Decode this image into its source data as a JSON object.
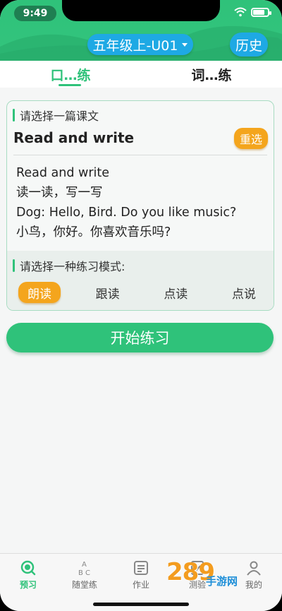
{
  "status_bar": {
    "time": "9:49"
  },
  "header": {
    "grade_selector": "五年级上-U01",
    "history_button": "历史"
  },
  "tabs": [
    {
      "label": "口…练",
      "active": true
    },
    {
      "label": "词…练",
      "active": false
    }
  ],
  "lesson_section": {
    "prompt": "请选择一篇课文",
    "title": "Read and write",
    "reselect_button": "重选",
    "lines": [
      "Read and write",
      "读一读，写一写",
      "Dog: Hello, Bird. Do you like music?",
      "小鸟，你好。你喜欢音乐吗?"
    ]
  },
  "mode_section": {
    "prompt": "请选择一种练习模式:",
    "modes": [
      {
        "label": "朗读",
        "selected": true
      },
      {
        "label": "跟读",
        "selected": false
      },
      {
        "label": "点读",
        "selected": false
      },
      {
        "label": "点说",
        "selected": false
      }
    ]
  },
  "start_button": "开始练习",
  "bottom_nav": [
    {
      "label": "预习",
      "icon": "search-icon",
      "active": true
    },
    {
      "label": "随堂练",
      "icon": "abc-icon",
      "active": false
    },
    {
      "label": "作业",
      "icon": "document-icon",
      "active": false
    },
    {
      "label": "测验",
      "icon": "quiz-icon",
      "active": false
    },
    {
      "label": "我的",
      "icon": "user-icon",
      "active": false
    }
  ],
  "watermark": {
    "main": "289",
    "sub": "手游网"
  },
  "colors": {
    "primary_green": "#2fc27a",
    "accent_blue": "#1ea9e4",
    "accent_orange": "#f4a51d"
  }
}
